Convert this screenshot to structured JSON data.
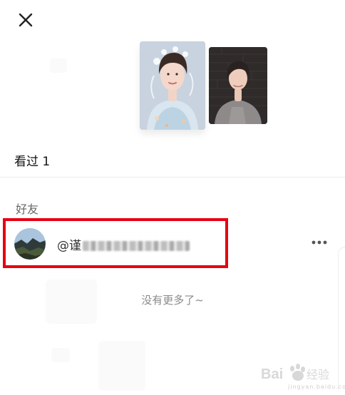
{
  "header": {
    "close_icon": "close-icon"
  },
  "tab": {
    "label": "看过 1"
  },
  "section": {
    "label": "好友"
  },
  "friend": {
    "handle_prefix": "@",
    "handle_visible_char": "谨",
    "more_icon": "more-horizontal-icon"
  },
  "footer": {
    "no_more_text": "没有更多了~"
  },
  "watermark": {
    "text": "Bai百度经验",
    "sub": "jingyan.baidu.com"
  },
  "colors": {
    "highlight": "#e60012",
    "text_primary": "#111111",
    "text_secondary": "#8a8a8a"
  }
}
